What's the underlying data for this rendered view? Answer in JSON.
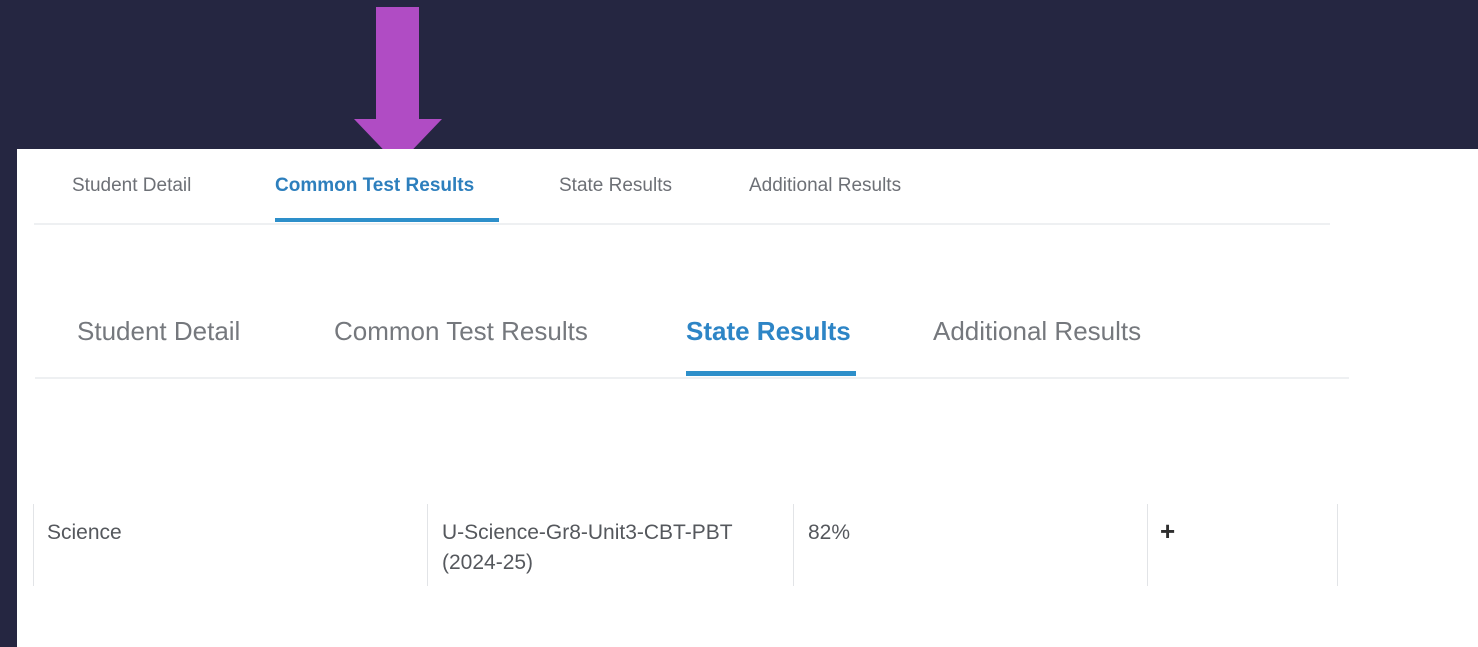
{
  "annotation": {
    "arrow_color": "#b04cc4",
    "arrow_icon": "arrow-down-icon"
  },
  "tabs_small": {
    "items": [
      {
        "label": "Student Detail",
        "active": false
      },
      {
        "label": "Common Test Results",
        "active": true
      },
      {
        "label": "State Results",
        "active": false
      },
      {
        "label": "Additional Results",
        "active": false
      }
    ]
  },
  "tabs_large": {
    "items": [
      {
        "label": "Student Detail",
        "active": false
      },
      {
        "label": "Common Test Results",
        "active": false
      },
      {
        "label": "State Results",
        "active": true
      },
      {
        "label": "Additional Results",
        "active": false
      }
    ]
  },
  "results_row": {
    "subject": "Science",
    "assessment": "U-Science-Gr8-Unit3-CBT-PBT (2024-25)",
    "score": "82%",
    "expand_icon": "plus-icon",
    "expand_symbol": "+"
  },
  "colors": {
    "accent": "#2d8fca",
    "background": "#252641",
    "panel": "#ffffff"
  }
}
